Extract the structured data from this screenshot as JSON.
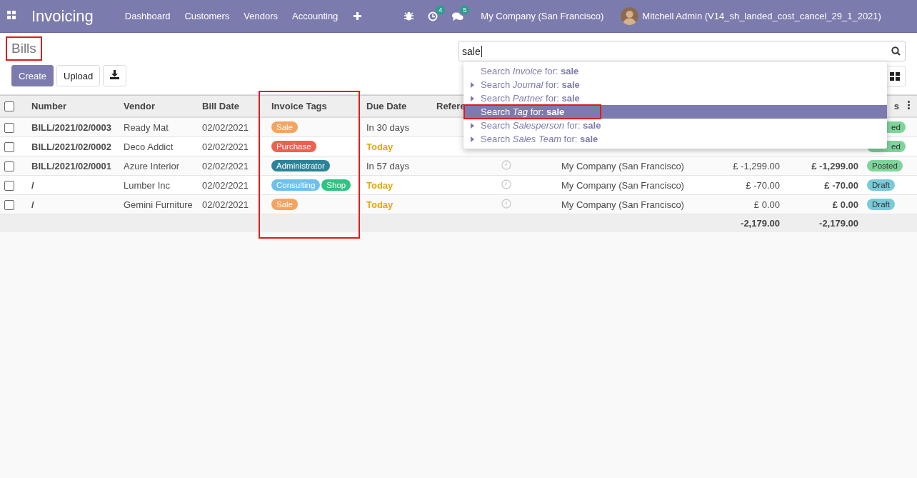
{
  "navbar": {
    "app_name": "Invoicing",
    "menu": [
      "Dashboard",
      "Customers",
      "Vendors",
      "Accounting"
    ],
    "activity_count": "4",
    "message_count": "5",
    "company": "My Company (San Francisco)",
    "user": "Mitchell Admin (V14_sh_landed_cost_cancel_29_1_2021)"
  },
  "page_title": {
    "text": "Bills",
    "highlighted": true
  },
  "buttons": [
    {
      "label": "Create",
      "kind": "primary"
    },
    {
      "label": "Upload",
      "kind": "secondary"
    },
    {
      "kind": "download"
    }
  ],
  "search": {
    "value": "sale"
  },
  "suggestions": [
    {
      "text": "Search *Invoice* for: **sale**",
      "expandable": false,
      "selected": false,
      "highlighted": false
    },
    {
      "text": "Search *Journal* for: **sale**",
      "expandable": true,
      "selected": false,
      "highlighted": false
    },
    {
      "text": "Search *Partner* for: **sale**",
      "expandable": true,
      "selected": false,
      "highlighted": false
    },
    {
      "text": "Search *Tag* for: **sale**",
      "expandable": false,
      "selected": true,
      "highlighted": true
    },
    {
      "text": "Search *Salesperson* for: **sale**",
      "expandable": true,
      "selected": false,
      "highlighted": false
    },
    {
      "text": "Search *Sales Team* for: **sale**",
      "expandable": true,
      "selected": false,
      "highlighted": false
    }
  ],
  "table": {
    "all_checked": false,
    "columns": [
      {
        "label": "Number",
        "highlighted": false
      },
      {
        "label": "Vendor",
        "highlighted": false
      },
      {
        "label": "Bill Date",
        "highlighted": false
      },
      {
        "label": "Invoice Tags",
        "highlighted": true
      },
      {
        "label": "Due Date",
        "highlighted": false
      },
      {
        "label": "Refere",
        "highlighted": false
      },
      {
        "label": "s",
        "highlighted": false
      }
    ],
    "rows": [
      {
        "checked": false,
        "number": "BILL/2021/02/0003",
        "vendor": "Ready Mat",
        "bill_date": "02/02/2021",
        "tags": [
          {
            "label": "Sale",
            "color": "#f4a460"
          }
        ],
        "due": "In 30 days",
        "due_warning": false,
        "status": {
          "label": "ed",
          "color": "#7ed59b",
          "cut": true
        }
      },
      {
        "checked": false,
        "number": "BILL/2021/02/0002",
        "vendor": "Deco Addict",
        "bill_date": "02/02/2021",
        "tags": [
          {
            "label": "Purchase",
            "color": "#f06050"
          }
        ],
        "due": "Today",
        "due_warning": true,
        "status": {
          "label": "ed",
          "color": "#7ed59b",
          "cut": true
        }
      },
      {
        "checked": false,
        "number": "BILL/2021/02/0001",
        "vendor": "Azure Interior",
        "bill_date": "02/02/2021",
        "tags": [
          {
            "label": "Administrator",
            "color": "#2c8397"
          }
        ],
        "due": "In 57 days",
        "due_warning": false,
        "activity": true,
        "company": "My Company (San Francisco)",
        "untaxed": "£ -1,299.00",
        "total": "£ -1,299.00",
        "status": {
          "label": "Posted",
          "color": "#7ed59b",
          "cut": false
        }
      },
      {
        "checked": false,
        "number": "/",
        "vendor": "Lumber Inc",
        "bill_date": "02/02/2021",
        "tags": [
          {
            "label": "Consulting",
            "color": "#6cc1ed"
          },
          {
            "label": "Shop",
            "color": "#30c381"
          }
        ],
        "due": "Today",
        "due_warning": true,
        "activity": true,
        "company": "My Company (San Francisco)",
        "untaxed": "£ -70.00",
        "total": "£ -70.00",
        "status": {
          "label": "Draft",
          "color": "#79cad8",
          "cut": false
        }
      },
      {
        "checked": false,
        "number": "/",
        "vendor": "Gemini Furniture",
        "bill_date": "02/02/2021",
        "tags": [
          {
            "label": "Sale",
            "color": "#f4a460"
          }
        ],
        "due": "Today",
        "due_warning": true,
        "activity": true,
        "company": "My Company (San Francisco)",
        "untaxed": "£ 0.00",
        "total": "£ 0.00",
        "status": {
          "label": "Draft",
          "color": "#79cad8",
          "cut": false
        }
      }
    ],
    "totals": {
      "untaxed": "-2,179.00",
      "total": "-2,179.00"
    }
  }
}
